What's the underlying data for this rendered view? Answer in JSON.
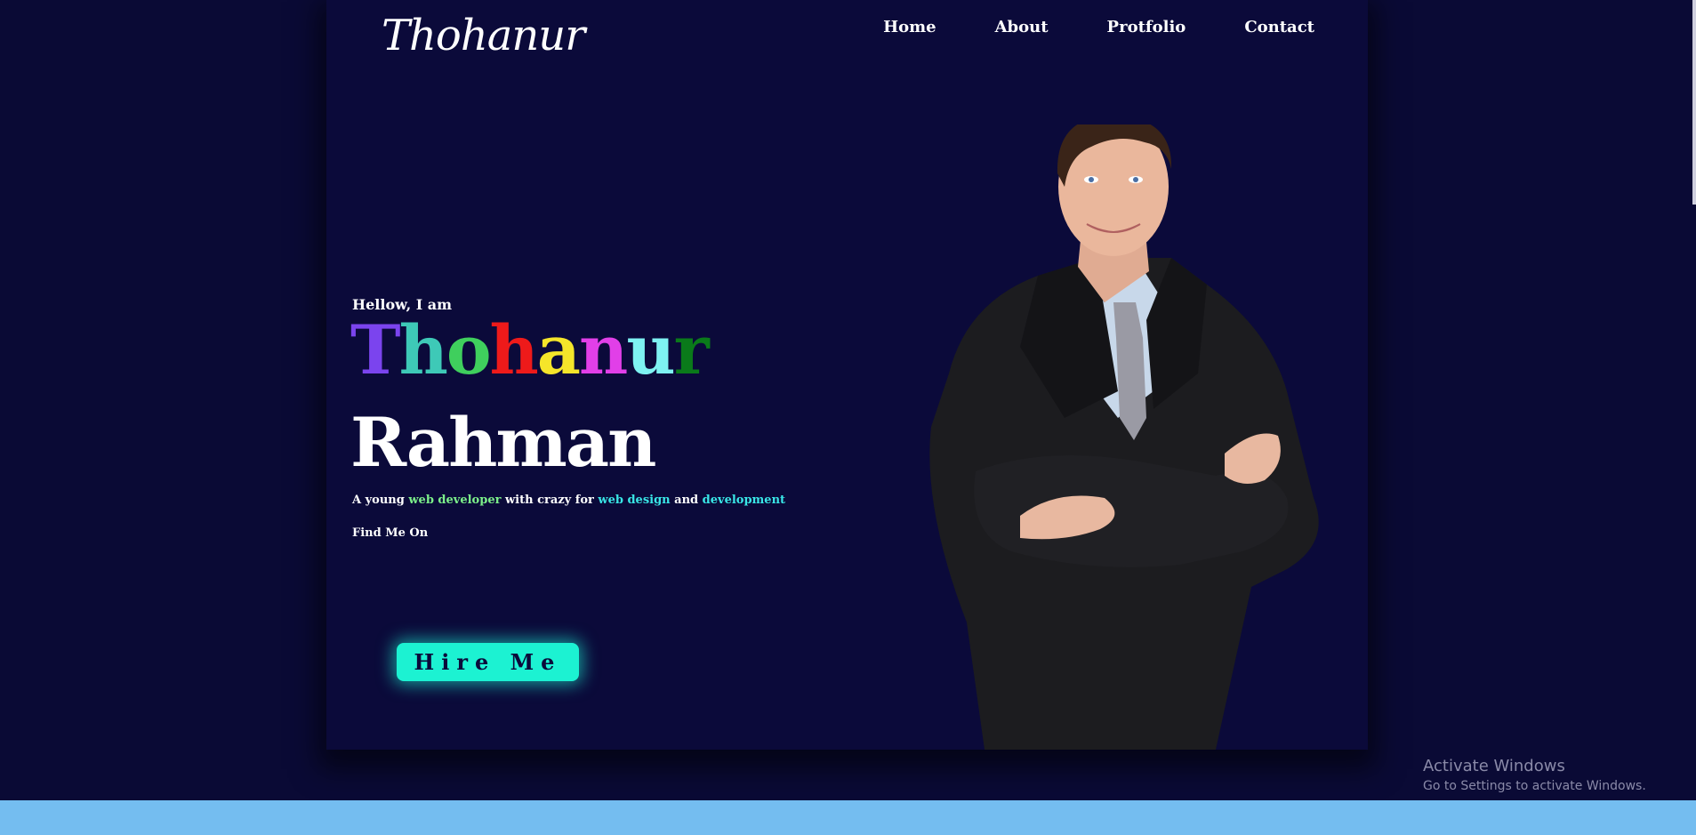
{
  "logo": {
    "text": "Thohanur"
  },
  "nav": {
    "items": [
      {
        "label": "Home"
      },
      {
        "label": "About"
      },
      {
        "label": "Protfolio"
      },
      {
        "label": "Contact"
      }
    ]
  },
  "hero": {
    "greeting": "Hellow, I am",
    "first_name_letters": [
      {
        "char": "T",
        "color": "#7b44ee"
      },
      {
        "char": "h",
        "color": "#3ec9b7"
      },
      {
        "char": "o",
        "color": "#3fcf5d"
      },
      {
        "char": "h",
        "color": "#ee1a1a"
      },
      {
        "char": "a",
        "color": "#f5e52a"
      },
      {
        "char": "n",
        "color": "#e13fe8"
      },
      {
        "char": "u",
        "color": "#7ef2f2"
      },
      {
        "char": "r",
        "color": "#0a7a1a"
      }
    ],
    "last_name": "Rahman",
    "tagline": {
      "part1": "A young ",
      "highlight1": "web developer",
      "part2": " with crazy for ",
      "highlight2": "web design",
      "part3": " and ",
      "highlight3": "development"
    },
    "find_me": "Find Me On",
    "hire_button": "Hire Me"
  },
  "photo": {
    "icon": "businessman-photo"
  },
  "watermark": {
    "line1": "Activate Windows",
    "line2": "Go to Settings to activate Windows."
  },
  "colors": {
    "page_bg": "#0a0a35",
    "card_bg": "#0b0a3a",
    "accent": "#1cf2d2",
    "taskbar": "#74bdf0"
  }
}
